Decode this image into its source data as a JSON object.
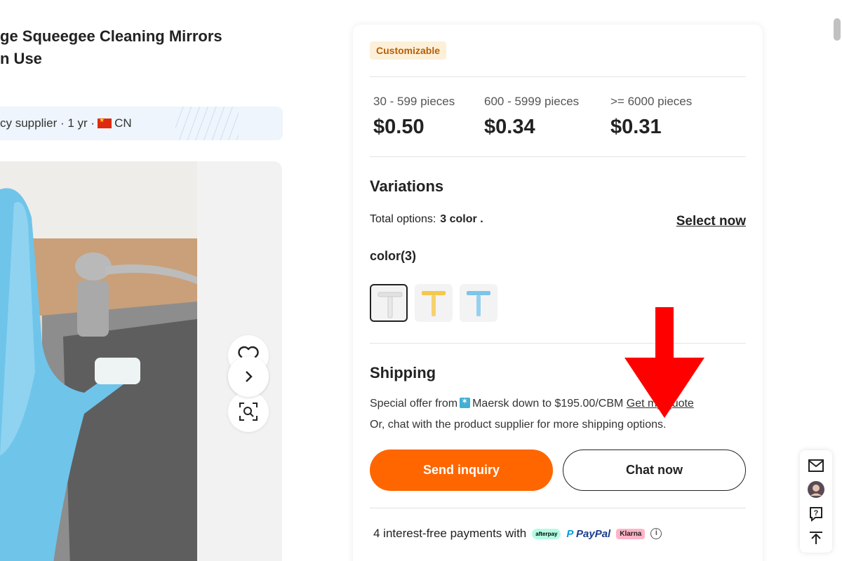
{
  "product": {
    "title": "ge Squeegee Cleaning Mirrors\nn Use"
  },
  "supplier": {
    "text_before_flag": "cy supplier · 1 yr ·",
    "country": "CN"
  },
  "gallery": {
    "favorite_icon": "heart-icon",
    "image_search_icon": "image-search-icon",
    "next_icon": "chevron-right-icon"
  },
  "card": {
    "badge": "Customizable",
    "tiers": [
      {
        "range": "30 - 599 pieces",
        "price": "$0.50"
      },
      {
        "range": "600 - 5999 pieces",
        "price": "$0.34"
      },
      {
        "range": ">= 6000 pieces",
        "price": "$0.31"
      }
    ],
    "variations": {
      "heading": "Variations",
      "total_label": "Total options:",
      "total_value": "3 color .",
      "select_now": "Select now",
      "color_label": "color(3)",
      "swatches": [
        {
          "name": "white",
          "color": "#e8e8e8",
          "selected": true
        },
        {
          "name": "yellow",
          "color": "#f4c84a",
          "selected": false
        },
        {
          "name": "blue",
          "color": "#7cc4ea",
          "selected": false
        }
      ]
    },
    "shipping": {
      "heading": "Shipping",
      "offer_prefix": "Special offer from",
      "carrier": "Maersk",
      "offer_suffix": "down to $195.00/CBM",
      "quote_link": "Get my quote",
      "note": "Or, chat with the product supplier for more shipping options."
    },
    "buttons": {
      "send_inquiry": "Send inquiry",
      "chat_now": "Chat now"
    },
    "payment": {
      "text": "4 interest-free payments with",
      "afterpay": "afterpay",
      "paypal": "PayPal",
      "klarna": "Klarna",
      "info_icon": "info-icon"
    }
  },
  "side_tools": [
    "mail-icon",
    "avatar",
    "help-icon",
    "back-to-top-icon"
  ],
  "annotation": {
    "color": "#ff0000",
    "shape": "down-arrow"
  }
}
